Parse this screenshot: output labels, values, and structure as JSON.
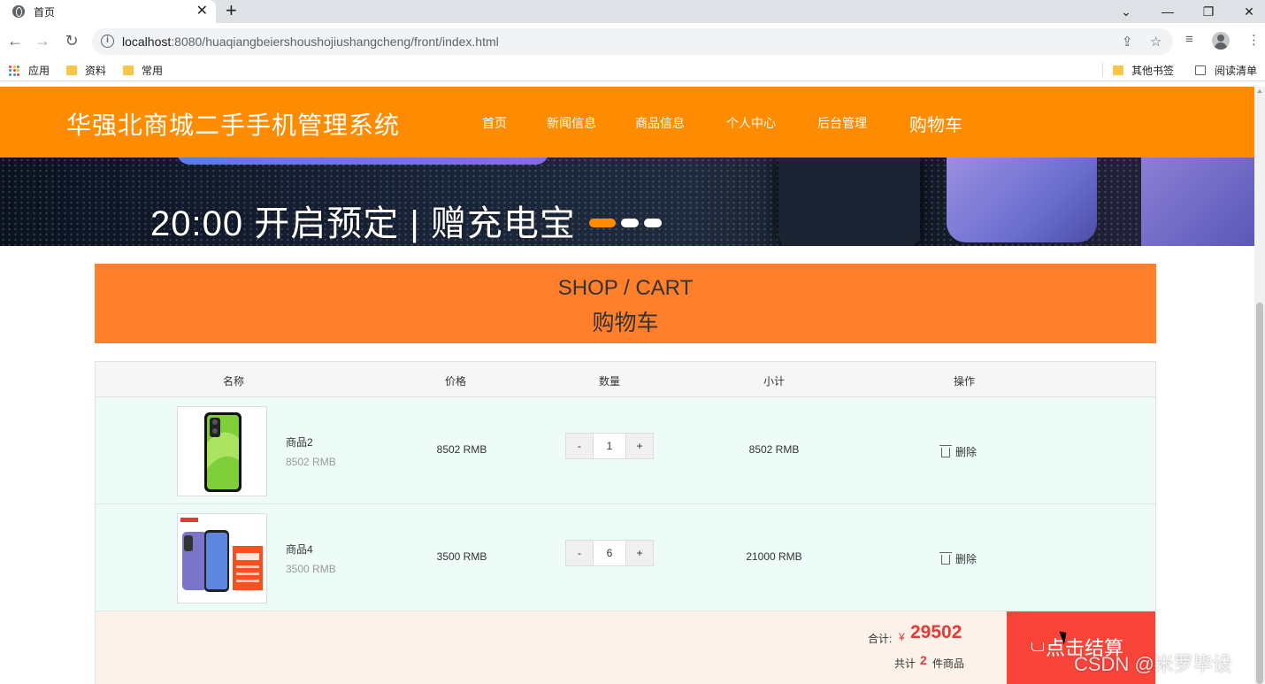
{
  "browser": {
    "tab_title": "首页",
    "url_host": "localhost",
    "url_rest": ":8080/huaqiangbeiershoushojiushangcheng/front/index.html",
    "bookmarks": [
      {
        "label": "应用"
      },
      {
        "label": "资料"
      },
      {
        "label": "常用"
      }
    ],
    "bookmarks_right": [
      {
        "label": "其他书签"
      },
      {
        "label": "阅读清单"
      }
    ]
  },
  "header": {
    "site_title": "华强北商城二手手机管理系统",
    "nav": [
      {
        "label": "首页"
      },
      {
        "label": "新闻信息"
      },
      {
        "label": "商品信息"
      },
      {
        "label": "个人中心"
      },
      {
        "label": "后台管理"
      },
      {
        "label": "购物车"
      }
    ],
    "active_nav": "购物车",
    "color": "#ff8c00"
  },
  "banner": {
    "text": "20:00 开启预定 | 赠充电宝",
    "slide_count": 3,
    "active_slide": 1
  },
  "cart_header": {
    "en": "SHOP / CART",
    "cn": "购物车"
  },
  "table": {
    "columns": [
      "名称",
      "价格",
      "数量",
      "小计",
      "操作"
    ],
    "rows": [
      {
        "name": "商品2",
        "unit_price": "8502 RMB",
        "price": "8502 RMB",
        "quantity": "1",
        "subtotal": "8502 RMB",
        "action": "删除",
        "decrement": "-",
        "increment": "+"
      },
      {
        "name": "商品4",
        "unit_price": "3500 RMB",
        "price": "3500 RMB",
        "quantity": "6",
        "subtotal": "21000 RMB",
        "action": "删除",
        "decrement": "-",
        "increment": "+"
      }
    ]
  },
  "summary": {
    "total_label": "合计:",
    "currency": "¥",
    "total": "29502",
    "count_prefix": "共计",
    "count": "2",
    "count_suffix": "件商品",
    "checkout_label": "点击结算",
    "accent": "#e53935"
  },
  "watermark": "CSDN @米罗毕设"
}
